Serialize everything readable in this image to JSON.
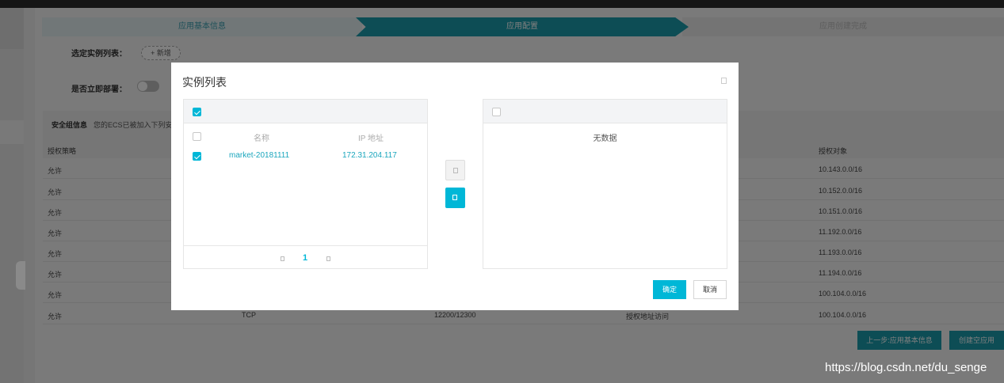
{
  "steps": [
    "应用基本信息",
    "应用配置",
    "应用创建完成"
  ],
  "form": {
    "instances_label": "选定实例列表：",
    "add_button": "+ 新增",
    "deploy_label": "是否立即部署："
  },
  "security": {
    "title": "安全组信息",
    "desc": "您的ECS已被加入下列安",
    "headers": {
      "policy": "授权策略",
      "target": "授权对象"
    },
    "rows": [
      {
        "policy": "允许",
        "protocol": "",
        "port": "",
        "type": "",
        "target": "10.143.0.0/16"
      },
      {
        "policy": "允许",
        "protocol": "",
        "port": "",
        "type": "",
        "target": "10.152.0.0/16"
      },
      {
        "policy": "允许",
        "protocol": "",
        "port": "",
        "type": "",
        "target": "10.151.0.0/16"
      },
      {
        "policy": "允许",
        "protocol": "",
        "port": "",
        "type": "",
        "target": "11.192.0.0/16"
      },
      {
        "policy": "允许",
        "protocol": "",
        "port": "",
        "type": "",
        "target": "11.193.0.0/16"
      },
      {
        "policy": "允许",
        "protocol": "",
        "port": "",
        "type": "",
        "target": "11.194.0.0/16"
      },
      {
        "policy": "允许",
        "protocol": "",
        "port": "",
        "type": "",
        "target": "100.104.0.0/16"
      },
      {
        "policy": "允许",
        "protocol": "TCP",
        "port": "12200/12300",
        "type": "授权地址访问",
        "target": "100.104.0.0/16"
      }
    ]
  },
  "footer": {
    "prev_button": "上一步:应用基本信息",
    "create_button": "创建空应用"
  },
  "modal": {
    "title": "实例列表",
    "left_panel": {
      "col_name": "名称",
      "col_ip": "IP 地址",
      "rows": [
        {
          "name": "market-20181111",
          "ip": "172.31.204.117",
          "checked": true
        }
      ],
      "page": "1"
    },
    "right_panel": {
      "empty_text": "无数据"
    },
    "ok_button": "确定",
    "cancel_button": "取消"
  },
  "watermark": "https://blog.csdn.net/du_senge",
  "colors": {
    "accent": "#00b7d7",
    "step_active": "#1b9aaa"
  }
}
